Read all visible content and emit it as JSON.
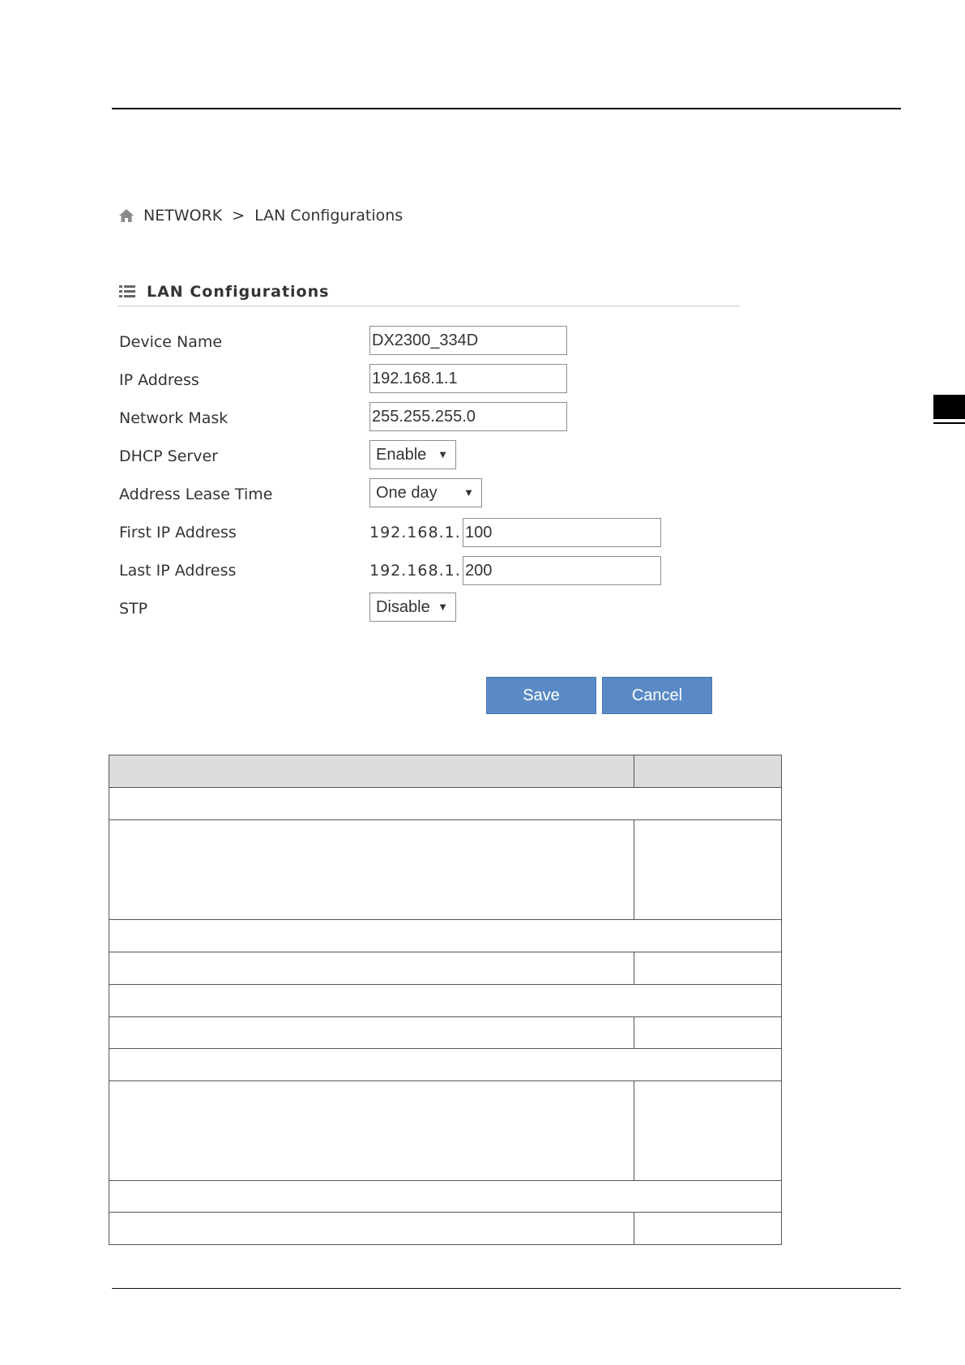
{
  "breadcrumb": {
    "root": "NETWORK",
    "separator": ">",
    "current": "LAN Configurations"
  },
  "section": {
    "title": "LAN Configurations"
  },
  "form": {
    "device_name": {
      "label": "Device Name",
      "value": "DX2300_334D"
    },
    "ip_address": {
      "label": "IP Address",
      "value": "192.168.1.1"
    },
    "network_mask": {
      "label": "Network Mask",
      "value": "255.255.255.0"
    },
    "dhcp_server": {
      "label": "DHCP Server",
      "value": "Enable"
    },
    "lease_time": {
      "label": "Address Lease Time",
      "value": "One day"
    },
    "first_ip": {
      "label": "First IP Address",
      "prefix": "192.168.1.",
      "value": "100"
    },
    "last_ip": {
      "label": "Last IP Address",
      "prefix": "192.168.1.",
      "value": "200"
    },
    "stp": {
      "label": "STP",
      "value": "Disable"
    }
  },
  "buttons": {
    "save": "Save",
    "cancel": "Cancel"
  },
  "icons": {
    "home": "home-icon",
    "list": "list-icon",
    "dropdown": "caret-down-icon"
  },
  "colors": {
    "button": "#5a8ac6",
    "table_header": "#dcdcdc"
  }
}
